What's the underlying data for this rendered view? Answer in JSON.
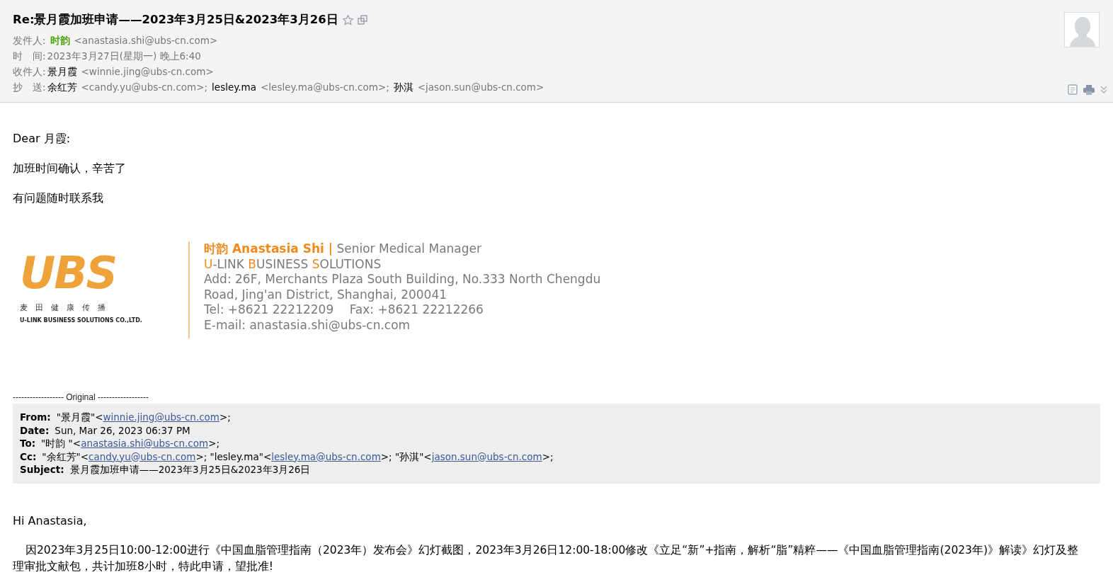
{
  "header": {
    "subject": "Re:景月霞加班申请——2023年3月25日&2023年3月26日",
    "fields": [
      {
        "kind": "sender",
        "label": "发件人:",
        "people": [
          {
            "name": "时韵",
            "email": "<anastasia.shi@ubs-cn.com>"
          }
        ]
      },
      {
        "kind": "text",
        "label": "时　间:",
        "value": "2023年3月27日(星期一) 晚上6:40"
      },
      {
        "kind": "people",
        "label": "收件人:",
        "people": [
          {
            "name": "景月霞",
            "email": "<winnie.jing@ubs-cn.com>"
          }
        ]
      },
      {
        "kind": "people",
        "label": "抄　送:",
        "people": [
          {
            "name": "余红芳",
            "email": "<candy.yu@ubs-cn.com>;"
          },
          {
            "name": "lesley.ma",
            "email": "<lesley.ma@ubs-cn.com>;"
          },
          {
            "name": "孙淇",
            "email": "<jason.sun@ubs-cn.com>"
          }
        ]
      }
    ]
  },
  "body": {
    "greeting": "Dear 月霞:",
    "lines": [
      "加班时间确认，辛苦了",
      "有问题随时联系我"
    ]
  },
  "signature": {
    "logo": {
      "mark": "UBS",
      "chinese": "麦　田　健　康　传　播",
      "english": "U-LINK BUSINESS SOLUTIONS CO.,LTD."
    },
    "name": "时韵 Anastasia Shi |",
    "title": "Senior Medical Manager",
    "company": "**U**-LINK **B**USINESS **S**OLUTIONS",
    "address": "Add: 26F, Merchants Plaza South Building, No.333 North Chengdu Road, Jing'an District, Shanghai, 200041",
    "phone": "Tel: +8621 22212209　 Fax: +8621 22212266",
    "email": "E-mail: anastasia.shi@ubs-cn.com"
  },
  "original": {
    "separator": "------------------ Original ------------------",
    "fields": [
      {
        "label": "From:",
        "parts": [
          {
            "text": "\"景月霞\"<"
          },
          {
            "link": "winnie.jing@ubs-cn.com"
          },
          {
            "text": ">;"
          }
        ]
      },
      {
        "label": "Date:",
        "parts": [
          {
            "text": "Sun, Mar 26, 2023 06:37 PM"
          }
        ]
      },
      {
        "label": "To:",
        "parts": [
          {
            "text": "\"时韵 \"<"
          },
          {
            "link": "anastasia.shi@ubs-cn.com"
          },
          {
            "text": ">;"
          }
        ]
      },
      {
        "label": "Cc:",
        "parts": [
          {
            "text": "\"余红芳\"<"
          },
          {
            "link": "candy.yu@ubs-cn.com"
          },
          {
            "text": ">; \"lesley.ma\"<"
          },
          {
            "link": "lesley.ma@ubs-cn.com"
          },
          {
            "text": ">; \"孙淇\"<"
          },
          {
            "link": "jason.sun@ubs-cn.com"
          },
          {
            "text": ">;"
          }
        ]
      },
      {
        "label": "Subject:",
        "parts": [
          {
            "text": "景月霞加班申请——2023年3月25日&2023年3月26日"
          }
        ]
      }
    ],
    "greeting": "Hi Anastasia,",
    "paragraph": "因2023年3月25日10:00-12:00进行《中国血脂管理指南（2023年）发布会》幻灯截图，2023年3月26日12:00-18:00修改《立足“新”+指南，解析“脂”精粹——《中国血脂管理指南(2023年)》解读》幻灯及整理审批文献包，共计加班8小时，特此申请，望批准!"
  }
}
